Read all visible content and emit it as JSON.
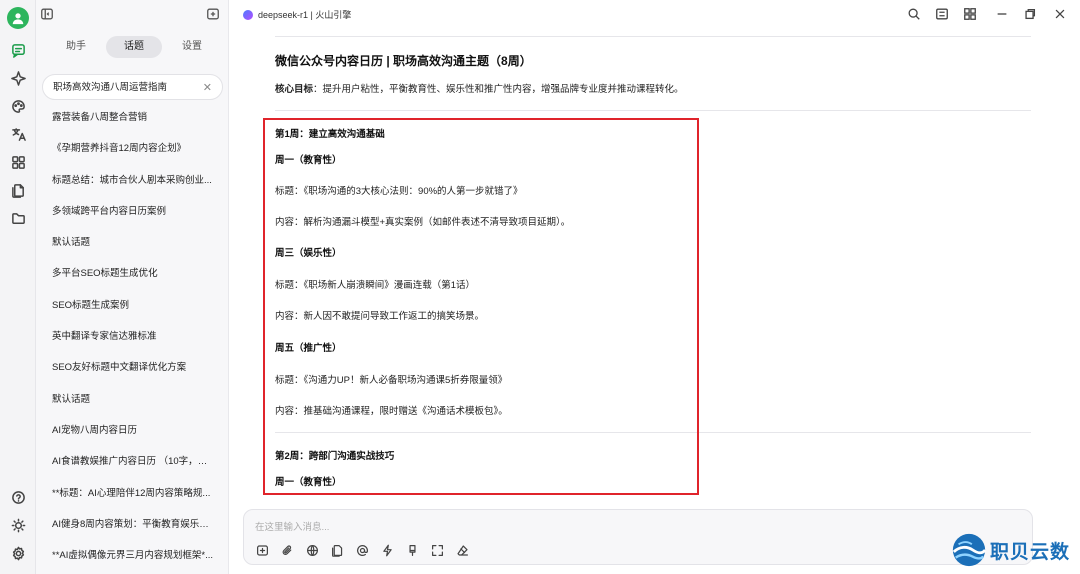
{
  "model": {
    "name": "deepseek-r1 | 火山引擎"
  },
  "sidebar": {
    "tabs": [
      {
        "label": "助手"
      },
      {
        "label": "话题"
      },
      {
        "label": "设置"
      }
    ],
    "topics": [
      {
        "label": "职场高效沟通八周运营指南"
      },
      {
        "label": "露营装备八周整合营销"
      },
      {
        "label": "《孕期营养抖音12周内容企划》"
      },
      {
        "label": "标题总结：城市合伙人剧本采购创业..."
      },
      {
        "label": "多领域跨平台内容日历案例"
      },
      {
        "label": "默认话题"
      },
      {
        "label": "多平台SEO标题生成优化"
      },
      {
        "label": "SEO标题生成案例"
      },
      {
        "label": "英中翻译专家信达雅标准"
      },
      {
        "label": "SEO友好标题中文翻译优化方案"
      },
      {
        "label": "默认话题"
      },
      {
        "label": "AI宠物八周内容日历"
      },
      {
        "label": "AI食谱教娱推广内容日历 （10字，中..."
      },
      {
        "label": "**标题：AI心理陪伴12周内容策略规..."
      },
      {
        "label": "AI健身8周内容策划：平衡教育娱乐营销"
      },
      {
        "label": "**AI虚拟偶像元界三月内容规划框架*..."
      }
    ]
  },
  "content": {
    "title": "微信公众号内容日历 | 职场高效沟通主题（8周）",
    "goal_label": "核心目标",
    "goal_text": "：提升用户粘性，平衡教育性、娱乐性和推广性内容，增强品牌专业度并推动课程转化。",
    "week1": {
      "heading": "第1周：建立高效沟通基础",
      "mon_heading": "周一（教育性）",
      "mon_title": "标题：《职场沟通的3大核心法则：90%的人第一步就错了》",
      "mon_content": "内容：解析沟通漏斗模型+真实案例（如邮件表述不清导致项目延期）。",
      "wed_heading": "周三（娱乐性）",
      "wed_title": "标题：《职场新人崩溃瞬间》漫画连载（第1话）",
      "wed_content": "内容：新人因不敢提问导致工作返工的搞笑场景。",
      "fri_heading": "周五（推广性）",
      "fri_title": "标题：《沟通力UP！新人必备职场沟通课5折券限量领》",
      "fri_content": "内容：推基础沟通课程，限时赠送《沟通话术模板包》。"
    },
    "week2": {
      "heading": "第2周：跨部门沟通实战技巧",
      "mon_heading": "周一（教育性）"
    }
  },
  "input": {
    "placeholder": "在这里输入消息..."
  },
  "watermark": {
    "text": "职贝云数"
  },
  "colors": {
    "accent": "#2db55d",
    "highlight_box": "#e0242b",
    "watermark": "#1b6fb8"
  }
}
